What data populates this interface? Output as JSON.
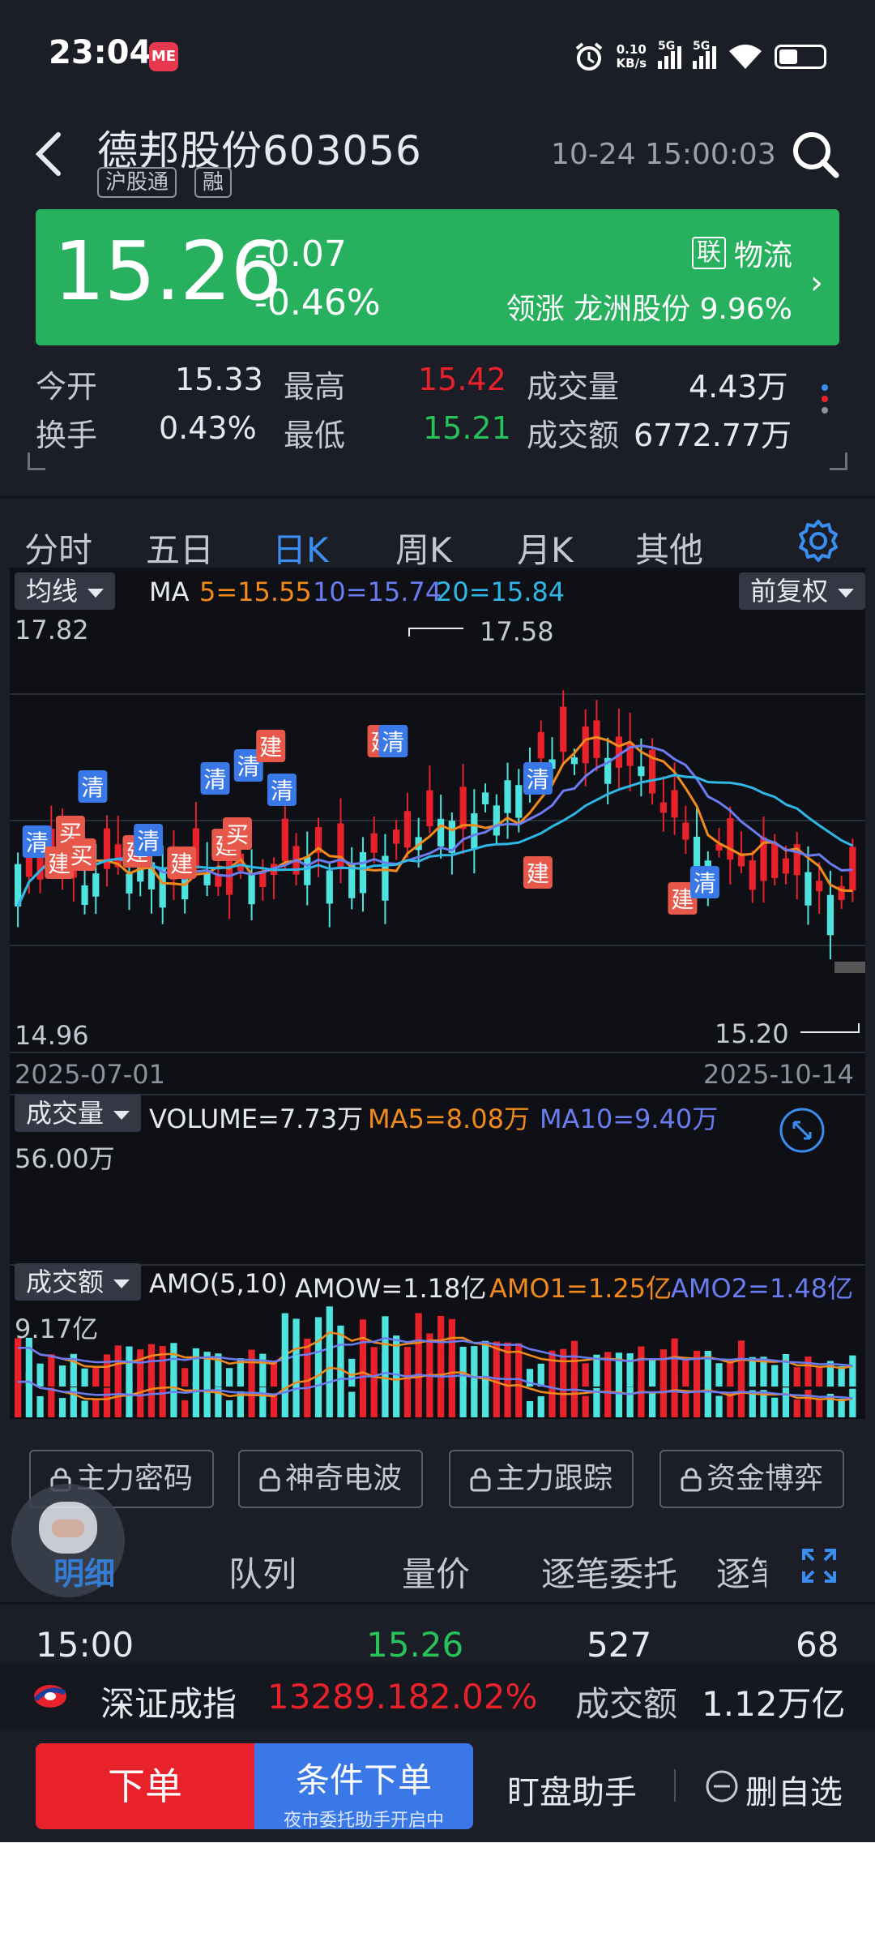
{
  "status_bar": {
    "time": "23:04",
    "app_badge": "ME",
    "net_speed": "0.10",
    "net_unit": "KB/s",
    "sim1": "5G",
    "sim2": "5G"
  },
  "header": {
    "title": "德邦股份603056",
    "tag1": "沪股通",
    "tag2": "融",
    "datetime": "10-24 15:00:03"
  },
  "quote": {
    "price": "15.26",
    "change": "-0.07",
    "change_pct": "-0.46%",
    "sector_box": "联",
    "sector_name": "物流",
    "leader": "领涨  龙洲股份  9.96%",
    "color": "#27b15e"
  },
  "stats": {
    "open_label": "今开",
    "open": "15.33",
    "high_label": "最高",
    "high": "15.42",
    "vol_label": "成交量",
    "vol": "4.43万",
    "turnover_label": "换手",
    "turnover": "0.43%",
    "low_label": "最低",
    "low": "15.21",
    "amount_label": "成交额",
    "amount": "6772.77万"
  },
  "tabs": {
    "items": [
      "分时",
      "五日",
      "日K",
      "周K",
      "月K",
      "其他"
    ],
    "active": "日K"
  },
  "kline": {
    "ind_dropdown": "均线",
    "ma_label": "MA",
    "ma5": "5=15.55",
    "ma10": "10=15.74",
    "ma20": "20=15.84",
    "adj_dropdown": "前复权",
    "top_price": "17.82",
    "bottom_price": "14.96",
    "max_mark": "17.58",
    "min_mark": "15.20",
    "date_start": "2025-07-01",
    "date_end": "2025-10-14",
    "colors": {
      "up": "#e8212b",
      "down": "#4fe3e0",
      "ma5": "#f28a1b",
      "ma10": "#6a7cf0",
      "ma20": "#2fb7e8"
    },
    "signals": {
      "buy": "买",
      "build": "建",
      "clear": "清"
    }
  },
  "volume": {
    "dropdown": "成交量",
    "label": "VOLUME=7.73万",
    "ma5": "MA5=8.08万",
    "ma10": "MA10=9.40万",
    "top": "56.00万"
  },
  "amount": {
    "dropdown": "成交额",
    "label": "AMO(5,10)",
    "amow": "AMOW=1.18亿",
    "amo1": "AMO1=1.25亿",
    "amo2": "AMO2=1.48亿",
    "top": "9.17亿"
  },
  "features": [
    "主力密码",
    "神奇电波",
    "主力跟踪",
    "资金博弈"
  ],
  "bottom_tabs": {
    "avatar": "明细",
    "items": [
      "队列",
      "量价",
      "逐笔委托",
      "逐笔"
    ]
  },
  "tick": {
    "time": "15:00",
    "price": "15.26",
    "volume": "527",
    "count": "68"
  },
  "index": {
    "name": "深证成指",
    "value": "13289.18",
    "pct": "2.02%",
    "amount_label": "成交额",
    "amount": "1.12万亿"
  },
  "order": {
    "place": "下单",
    "cond": "条件下单",
    "cond_sub": "夜市委托助手开启中",
    "assist": "盯盘助手",
    "remove": "删自选"
  }
}
